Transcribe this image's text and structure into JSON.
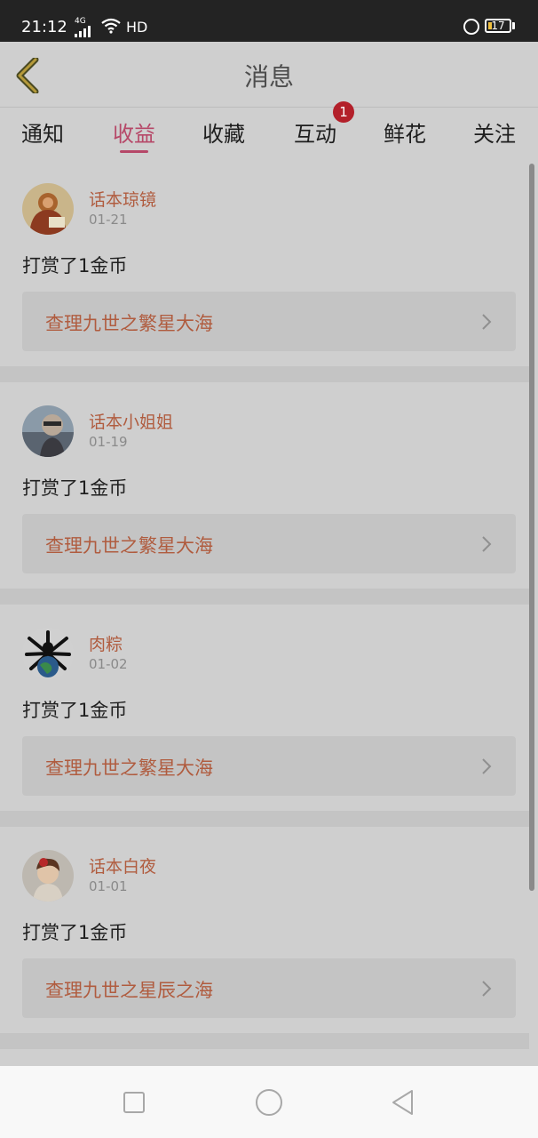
{
  "status_bar": {
    "time": "21:12",
    "network": "4G",
    "hd": "HD",
    "battery": "17"
  },
  "header": {
    "title": "消息",
    "back_icon": "chevron-left-icon"
  },
  "tabs": [
    {
      "label": "通知",
      "active": false
    },
    {
      "label": "收益",
      "active": true
    },
    {
      "label": "收藏",
      "active": false
    },
    {
      "label": "互动",
      "active": false,
      "badge": "1"
    },
    {
      "label": "鲜花",
      "active": false
    },
    {
      "label": "关注",
      "active": false
    }
  ],
  "messages": [
    {
      "username": "话本琼镜",
      "date": "01-21",
      "action": "打赏了1金币",
      "book": "查理九世之繁星大海",
      "avatar": "avatar-robed-figure"
    },
    {
      "username": "话本小姐姐",
      "date": "01-19",
      "action": "打赏了1金币",
      "book": "查理九世之繁星大海",
      "avatar": "avatar-photo"
    },
    {
      "username": "肉粽",
      "date": "01-02",
      "action": "打赏了1金币",
      "book": "查理九世之繁星大海",
      "avatar": "avatar-globe-emblem"
    },
    {
      "username": "话本白夜",
      "date": "01-01",
      "action": "打赏了1金币",
      "book": "查理九世之星辰之海",
      "avatar": "avatar-girl"
    }
  ],
  "colors": {
    "accent": "#b64868",
    "username": "#b05c3f",
    "badge": "#b3202a"
  },
  "nav_bar": {
    "recent_icon": "square-icon",
    "home_icon": "circle-icon",
    "back_icon": "triangle-back-icon"
  }
}
